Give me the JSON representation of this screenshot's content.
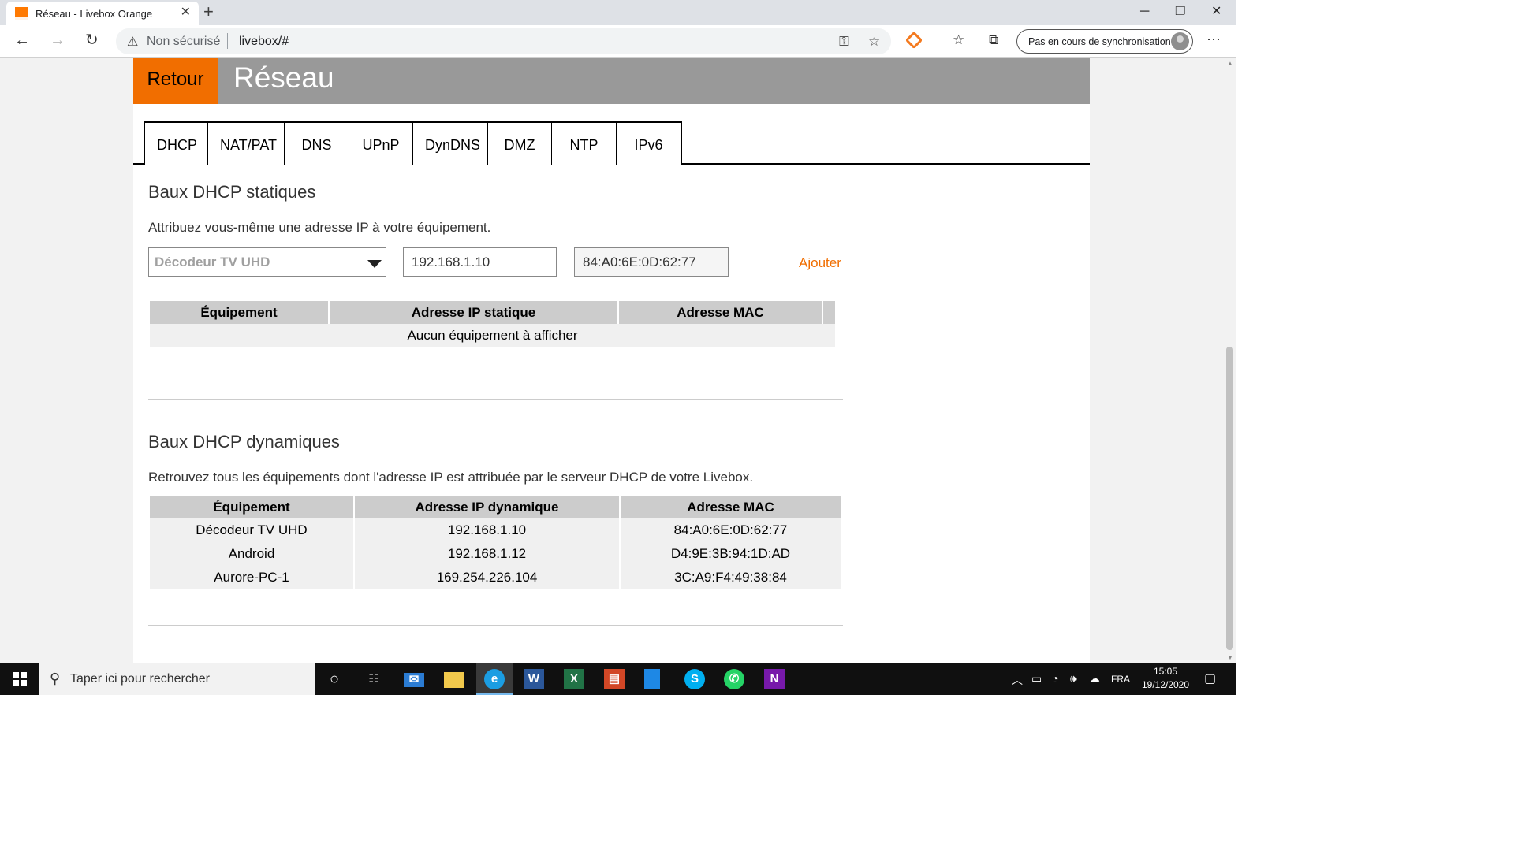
{
  "browser": {
    "tab_title": "Réseau - Livebox Orange",
    "security_label": "Non sécurisé",
    "url": "livebox/#",
    "sync_label": "Pas en cours de synchronisation"
  },
  "header": {
    "back_label": "Retour",
    "title": "Réseau"
  },
  "tabs": [
    "DHCP",
    "NAT/PAT",
    "DNS",
    "UPnP",
    "DynDNS",
    "DMZ",
    "NTP",
    "IPv6"
  ],
  "active_tab": "DHCP",
  "static": {
    "title": "Baux DHCP statiques",
    "description": "Attribuez vous-même une adresse IP à votre équipement.",
    "device_select": "Décodeur TV UHD",
    "ip_value": "192.168.1.10",
    "mac_value": "84:A0:6E:0D:62:77",
    "add_label": "Ajouter",
    "columns": [
      "Équipement",
      "Adresse IP statique",
      "Adresse MAC"
    ],
    "empty_message": "Aucun équipement à afficher"
  },
  "dynamic": {
    "title": "Baux DHCP dynamiques",
    "description": "Retrouvez tous les équipements dont l'adresse IP est attribuée par le serveur DHCP de votre Livebox.",
    "columns": [
      "Équipement",
      "Adresse IP dynamique",
      "Adresse MAC"
    ],
    "rows": [
      [
        "Décodeur TV UHD",
        "192.168.1.10",
        "84:A0:6E:0D:62:77"
      ],
      [
        "Android",
        "192.168.1.12",
        "D4:9E:3B:94:1D:AD"
      ],
      [
        "Aurore-PC-1",
        "169.254.226.104",
        "3C:A9:F4:49:38:84"
      ]
    ]
  },
  "taskbar": {
    "search_placeholder": "Taper ici pour rechercher",
    "language": "FRA",
    "time": "15:05",
    "date": "19/12/2020"
  },
  "colors": {
    "orange": "#f16e00",
    "header_gray": "#999999",
    "table_header": "#cccccc"
  }
}
